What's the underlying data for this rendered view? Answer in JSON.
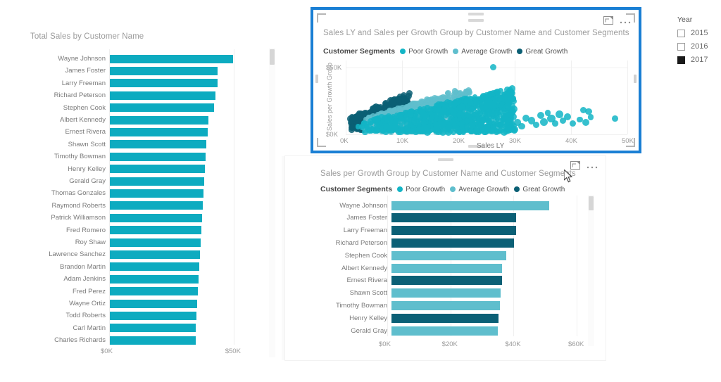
{
  "left_chart": {
    "title": "Total Sales by Customer Name",
    "axis_ticks": [
      "$0K",
      "$50K"
    ],
    "bar_color": "#0dabc0",
    "categories": [
      "Wayne Johnson",
      "James Foster",
      "Larry Freeman",
      "Richard Peterson",
      "Stephen Cook",
      "Albert Kennedy",
      "Ernest Rivera",
      "Shawn Scott",
      "Timothy Bowman",
      "Henry Kelley",
      "Gerald Gray",
      "Thomas Gonzales",
      "Raymond Roberts",
      "Patrick Williamson",
      "Fred Romero",
      "Roy Shaw",
      "Lawrence Sanchez",
      "Brandon Martin",
      "Adam Jenkins",
      "Fred Perez",
      "Wayne Ortiz",
      "Todd Roberts",
      "Carl Martin",
      "Charles Richards"
    ],
    "values": [
      49.5,
      43.4,
      43.2,
      42.5,
      41.8,
      39.6,
      39.4,
      38.9,
      38.6,
      38.2,
      38.0,
      37.6,
      37.4,
      37.2,
      36.9,
      36.5,
      36.3,
      35.9,
      35.6,
      35.3,
      35.2,
      34.9,
      34.6,
      34.4
    ]
  },
  "scatter_panel": {
    "title": "Sales LY and Sales per Growth Group by Customer Name and Customer Segments",
    "legend_label": "Customer Segments",
    "legend": [
      {
        "name": "Poor Growth",
        "color": "#13b5c6"
      },
      {
        "name": "Average Growth",
        "color": "#5fbecd"
      },
      {
        "name": "Great Growth",
        "color": "#0b5f74"
      }
    ],
    "focus_icon": "focus-mode-icon",
    "more_icon": "more-options-icon",
    "selected": true,
    "border_color": "#1a7fd4"
  },
  "bottom_chart": {
    "title": "Sales per Growth Group by Customer Name and Customer Segments",
    "legend_label": "Customer Segments",
    "legend": [
      {
        "name": "Poor Growth",
        "color": "#13b5c6"
      },
      {
        "name": "Average Growth",
        "color": "#5fbecd"
      },
      {
        "name": "Great Growth",
        "color": "#0b5f74"
      }
    ],
    "axis_ticks": [
      "$0K",
      "$20K",
      "$40K",
      "$60K"
    ],
    "rows": [
      {
        "name": "Wayne Johnson",
        "value": 50.0,
        "segment": "Average Growth",
        "color": "#5fbecd"
      },
      {
        "name": "James Foster",
        "value": 39.5,
        "segment": "Great Growth",
        "color": "#0b6076"
      },
      {
        "name": "Larry Freeman",
        "value": 39.4,
        "segment": "Great Growth",
        "color": "#0b6076"
      },
      {
        "name": "Richard Peterson",
        "value": 38.9,
        "segment": "Great Growth",
        "color": "#0b6076"
      },
      {
        "name": "Stephen Cook",
        "value": 36.4,
        "segment": "Average Growth",
        "color": "#5fbecd"
      },
      {
        "name": "Albert Kennedy",
        "value": 35.1,
        "segment": "Average Growth",
        "color": "#5fbecd"
      },
      {
        "name": "Ernest Rivera",
        "value": 35.0,
        "segment": "Great Growth",
        "color": "#0b6076"
      },
      {
        "name": "Shawn Scott",
        "value": 34.5,
        "segment": "Average Growth",
        "color": "#5fbecd"
      },
      {
        "name": "Timothy Bowman",
        "value": 34.3,
        "segment": "Average Growth",
        "color": "#5fbecd"
      },
      {
        "name": "Henry Kelley",
        "value": 33.9,
        "segment": "Great Growth",
        "color": "#0b6076"
      },
      {
        "name": "Gerald Gray",
        "value": 33.7,
        "segment": "Average Growth",
        "color": "#5fbecd"
      }
    ],
    "focus_icon": "focus-mode-icon",
    "more_icon": "more-options-icon"
  },
  "slicer": {
    "title": "Year",
    "items": [
      {
        "label": "2015",
        "checked": false
      },
      {
        "label": "2016",
        "checked": false
      },
      {
        "label": "2017",
        "checked": true
      }
    ]
  },
  "chart_data": [
    {
      "type": "bar",
      "orientation": "horizontal",
      "title": "Total Sales by Customer Name",
      "xlabel": "",
      "ylabel": "",
      "xlim": [
        0,
        58
      ],
      "xticks": [
        "$0K",
        "$50K"
      ],
      "grid": true,
      "categories": [
        "Wayne Johnson",
        "James Foster",
        "Larry Freeman",
        "Richard Peterson",
        "Stephen Cook",
        "Albert Kennedy",
        "Ernest Rivera",
        "Shawn Scott",
        "Timothy Bowman",
        "Henry Kelley",
        "Gerald Gray",
        "Thomas Gonzales",
        "Raymond Roberts",
        "Patrick Williamson",
        "Fred Romero",
        "Roy Shaw",
        "Lawrence Sanchez",
        "Brandon Martin",
        "Adam Jenkins",
        "Fred Perez",
        "Wayne Ortiz",
        "Todd Roberts",
        "Carl Martin",
        "Charles Richards"
      ],
      "values": [
        49.5,
        43.4,
        43.2,
        42.5,
        41.8,
        39.6,
        39.4,
        38.9,
        38.6,
        38.2,
        38.0,
        37.6,
        37.4,
        37.2,
        36.9,
        36.5,
        36.3,
        35.9,
        35.6,
        35.3,
        35.2,
        34.9,
        34.6,
        34.4
      ]
    },
    {
      "type": "scatter",
      "title": "Sales LY and Sales per Growth Group by Customer Name and Customer Segments",
      "xlabel": "Sales LY",
      "ylabel": "Sales per Growth Group",
      "xticks": [
        "0K",
        "10K",
        "20K",
        "30K",
        "40K",
        "50K"
      ],
      "yticks": [
        "$0K",
        "$50K"
      ],
      "xlim": [
        0,
        50
      ],
      "ylim": [
        0,
        55
      ],
      "grid": true,
      "legend_position": "top",
      "series": [
        {
          "name": "Poor Growth",
          "color": "#13b5c6"
        },
        {
          "name": "Average Growth",
          "color": "#5fbecd"
        },
        {
          "name": "Great Growth",
          "color": "#0b5f74"
        }
      ]
    },
    {
      "type": "bar",
      "orientation": "horizontal",
      "title": "Sales per Growth Group by Customer Name and Customer Segments",
      "xlabel": "",
      "ylabel": "",
      "xlim": [
        0,
        62
      ],
      "xticks": [
        "$0K",
        "$20K",
        "$40K",
        "$60K"
      ],
      "grid": true,
      "legend_position": "top",
      "categories": [
        "Wayne Johnson",
        "James Foster",
        "Larry Freeman",
        "Richard Peterson",
        "Stephen Cook",
        "Albert Kennedy",
        "Ernest Rivera",
        "Shawn Scott",
        "Timothy Bowman",
        "Henry Kelley",
        "Gerald Gray"
      ],
      "values": [
        50.0,
        39.5,
        39.4,
        38.9,
        36.4,
        35.1,
        35.0,
        34.5,
        34.3,
        33.9,
        33.7
      ],
      "point_colors": [
        "#5fbecd",
        "#0b6076",
        "#0b6076",
        "#0b6076",
        "#5fbecd",
        "#5fbecd",
        "#0b6076",
        "#5fbecd",
        "#5fbecd",
        "#0b6076",
        "#5fbecd"
      ]
    }
  ]
}
